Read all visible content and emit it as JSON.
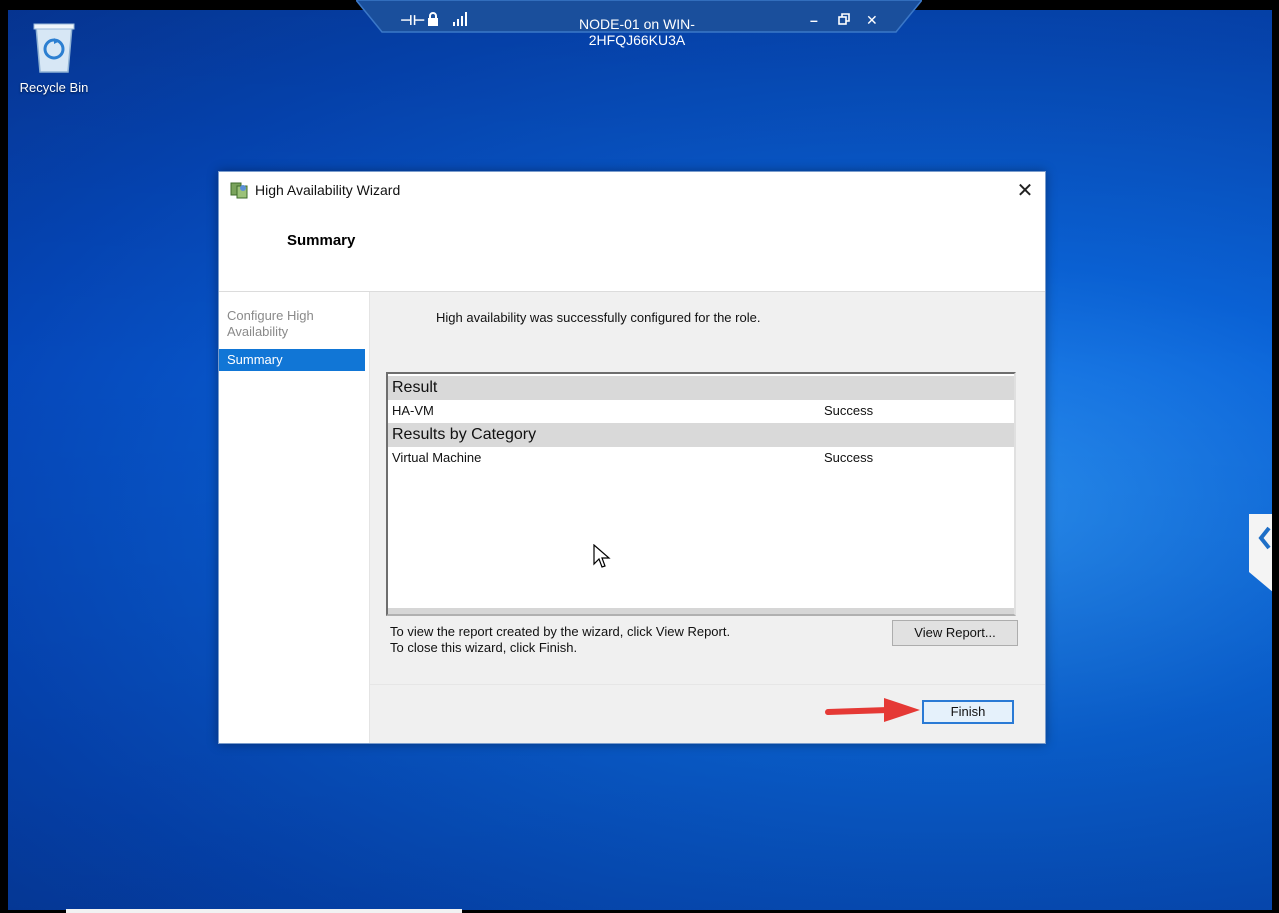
{
  "desktop": {
    "recycle_bin_label": "Recycle Bin"
  },
  "remote_bar": {
    "title": "NODE-01 on WIN-2HFQJ66KU3A",
    "icons": [
      "pin-icon",
      "lock-icon",
      "signal-icon",
      "minimize-icon",
      "restore-icon",
      "close-icon"
    ]
  },
  "wizard": {
    "title": "High Availability Wizard",
    "heading": "Summary",
    "steps": [
      {
        "label": "Configure High Availability",
        "active": false
      },
      {
        "label": "Summary",
        "active": true
      }
    ],
    "success_message": "High availability was successfully configured for the role.",
    "results": {
      "result_header": "Result",
      "result_rows": [
        {
          "name": "HA-VM",
          "status": "Success"
        }
      ],
      "category_header": "Results by Category",
      "category_rows": [
        {
          "name": "Virtual Machine",
          "status": "Success"
        }
      ]
    },
    "help_line_1": "To view the report created by the wizard, click View Report.",
    "help_line_2": "To close this wizard, click Finish.",
    "view_report_label": "View Report...",
    "finish_label": "Finish"
  },
  "colors": {
    "desktop_blue": "#0a63d8",
    "selection_blue": "#1176d6",
    "annotation_red": "#e53935"
  }
}
